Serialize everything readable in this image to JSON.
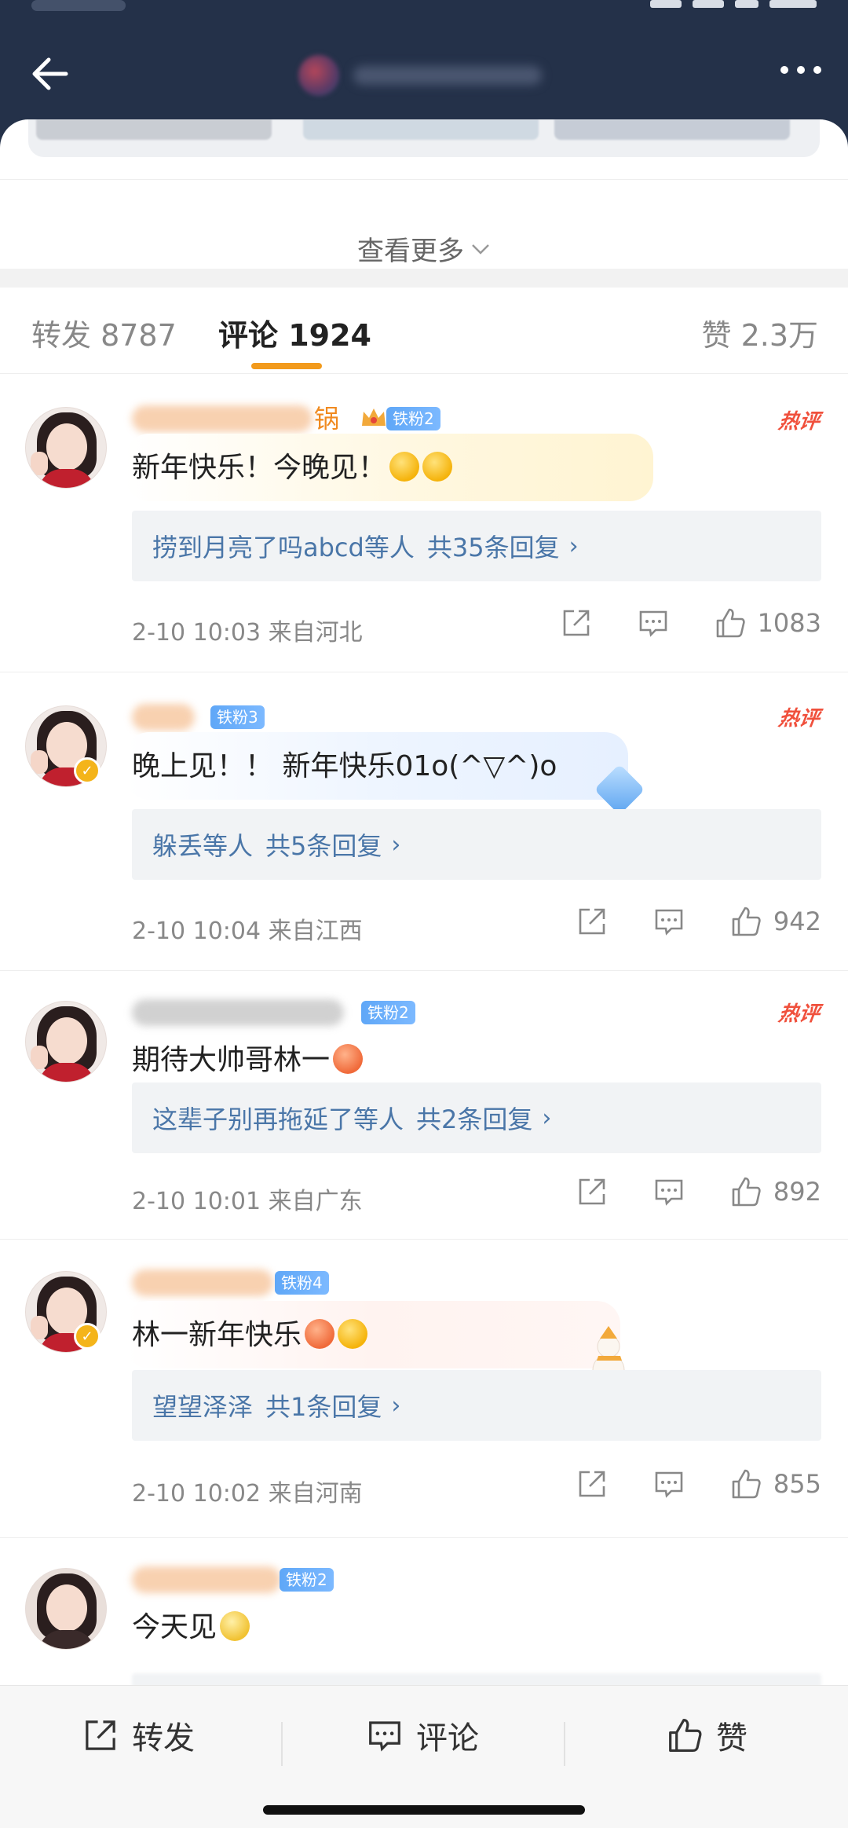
{
  "header": {
    "back_icon": "arrow-left-icon",
    "more_icon": "more-dots-icon"
  },
  "post": {
    "see_more_label": "查看更多"
  },
  "tabs": [
    {
      "label": "转发 8787",
      "active": false
    },
    {
      "label": "评论 1924",
      "active": true
    },
    {
      "label": "赞 2.3万",
      "active": false
    }
  ],
  "comments": [
    {
      "name_tail": "锅",
      "fan_badge": "铁粉2",
      "hot_label": "热评",
      "text": "新年快乐！今晚见！",
      "replies_who": "捞到月亮了吗abcd等人",
      "replies_total": "共35条回复",
      "replies_arrow": "›",
      "time": "2-10 10:03",
      "location": "来自河北",
      "likes": "1083"
    },
    {
      "fan_badge": "铁粉3",
      "hot_label": "热评",
      "text": "晚上见！！ 新年快乐01o(^▽^)o",
      "replies_who": "躲丢等人",
      "replies_total": "共5条回复",
      "replies_arrow": "›",
      "time": "2-10 10:04",
      "location": "来自江西",
      "likes": "942"
    },
    {
      "fan_badge": "铁粉2",
      "hot_label": "热评",
      "text": "期待大帅哥林一",
      "replies_who": "这辈子别再拖延了等人",
      "replies_total": "共2条回复",
      "replies_arrow": "›",
      "time": "2-10 10:01",
      "location": "来自广东",
      "likes": "892"
    },
    {
      "fan_badge": "铁粉4",
      "text": "林一新年快乐",
      "replies_who": "望望泽泽",
      "replies_total": "共1条回复",
      "replies_arrow": "›",
      "time": "2-10 10:02",
      "location": "来自河南",
      "likes": "855"
    },
    {
      "fan_badge": "铁粉2",
      "text": "今天见"
    }
  ],
  "bottom_bar": {
    "repost_label": "转发",
    "comment_label": "评论",
    "like_label": "赞"
  },
  "colors": {
    "header_bg": "#243149",
    "accent_orange": "#f29a1c",
    "link_blue": "#4a76a8",
    "hot_red": "#f0503c",
    "fan_badge_blue": "#5fa7f7"
  }
}
